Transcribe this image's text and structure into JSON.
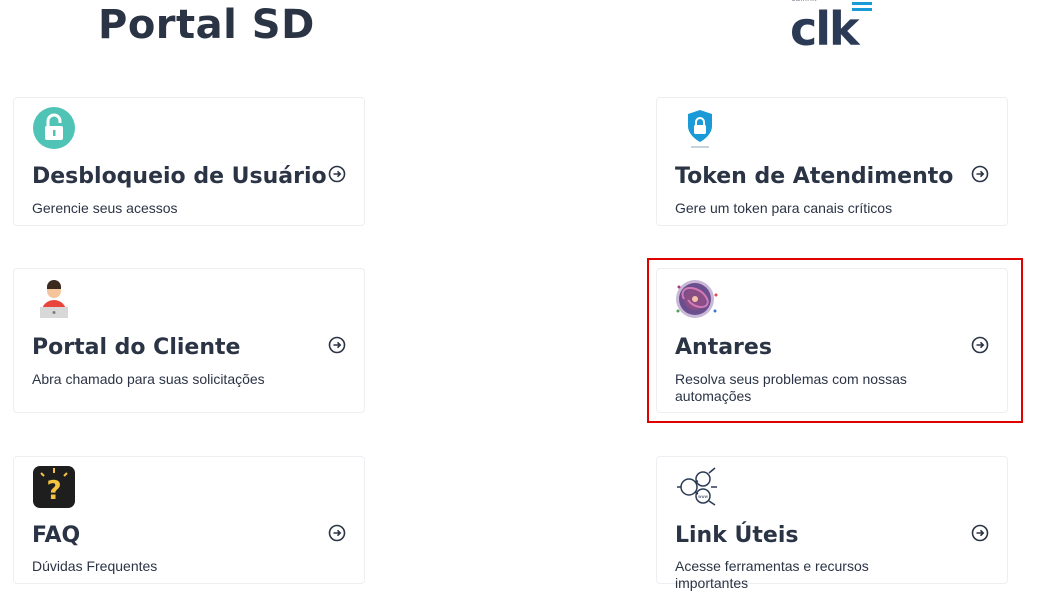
{
  "header": {
    "title": "Portal SD",
    "brand_logo": "clk",
    "brand_small": "callink"
  },
  "cards": [
    {
      "title": "Desbloqueio de Usuário",
      "description": "Gerencie seus acessos",
      "icon": "lock-icon"
    },
    {
      "title": "Token de Atendimento",
      "description": "Gere um token para canais críticos",
      "icon": "shield-lock-icon"
    },
    {
      "title": "Portal do Cliente",
      "description": "Abra chamado para suas solicitações",
      "icon": "user-laptop-icon"
    },
    {
      "title": "Antares",
      "description": "Resolva seus problemas com nossas automações",
      "icon": "galaxy-icon"
    },
    {
      "title": "FAQ",
      "description": "Dúvidas Frequentes",
      "icon": "question-bulb-icon"
    },
    {
      "title": "Link Úteis",
      "description": "Acesse ferramentas e recursos importantes",
      "icon": "network-nodes-icon"
    }
  ],
  "colors": {
    "text": "#2b3445",
    "highlight": "#e00000",
    "teal": "#4fc3b5",
    "blue": "#1a9bd7"
  }
}
